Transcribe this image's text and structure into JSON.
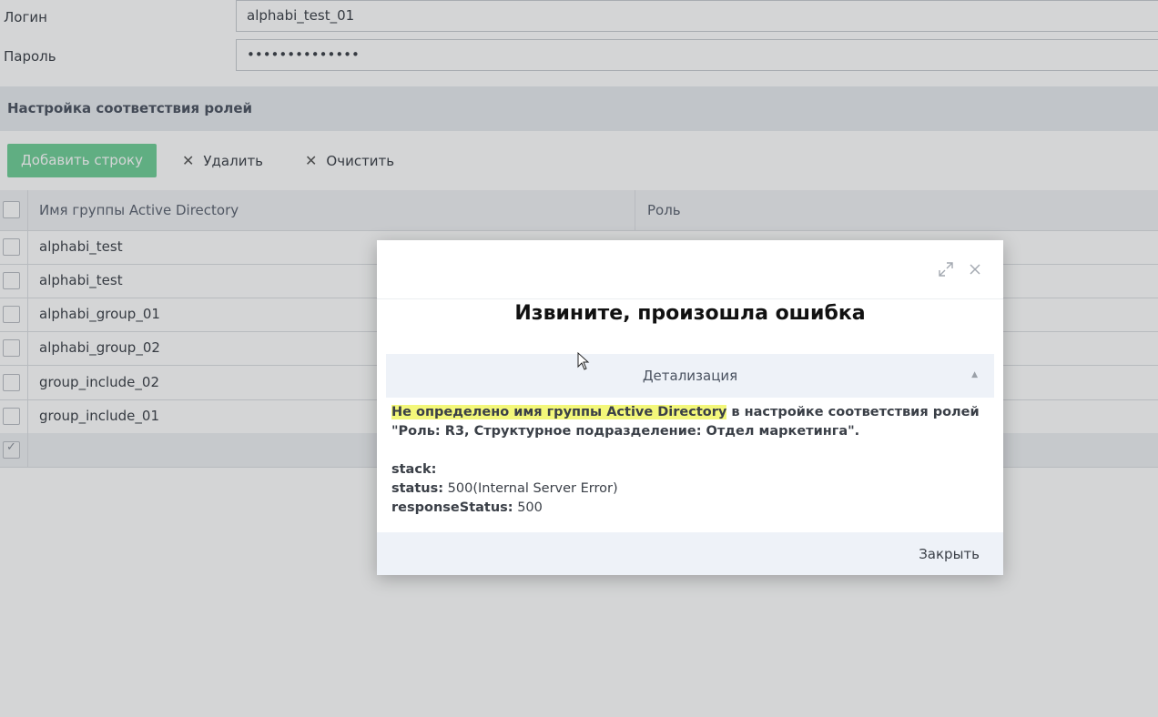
{
  "form": {
    "login_label": "Логин",
    "login_value": "alphabi_test_01",
    "password_label": "Пароль",
    "password_value": "••••••••••••••"
  },
  "section": {
    "title": "Настройка соответствия ролей"
  },
  "toolbar": {
    "add_label": "Добавить строку",
    "delete_label": "Удалить",
    "clear_label": "Очистить"
  },
  "grid": {
    "columns": [
      "Имя группы Active Directory",
      "Роль"
    ],
    "rows": [
      "alphabi_test",
      "alphabi_test",
      "alphabi_group_01",
      "alphabi_group_02",
      "group_include_02",
      "group_include_01"
    ]
  },
  "dialog": {
    "title": "Извините, произошла ошибка",
    "details_label": "Детализация",
    "message_highlight": "Не определено имя группы Active Directory",
    "message_rest": " в настройке соответствия ролей \"Роль: R3, Структурное подразделение: Отдел маркетинга\".",
    "stack_label": "stack:",
    "status_label": "status:",
    "status_value": " 500(Internal Server Error)",
    "response_label": "responseStatus:",
    "response_value": " 500",
    "close_label": "Закрыть"
  },
  "colors": {
    "accent_green": "#6fcf97",
    "highlight": "#f3f77a"
  }
}
